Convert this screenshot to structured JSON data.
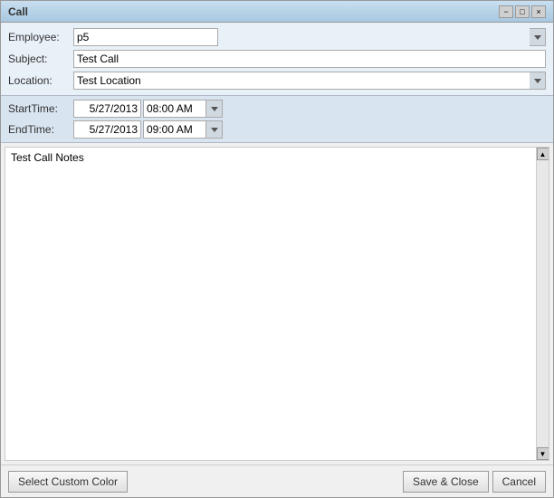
{
  "window": {
    "title": "Call",
    "subtitle": ""
  },
  "titleBar": {
    "minimize_label": "−",
    "maximize_label": "□",
    "close_label": "×"
  },
  "form": {
    "employee_label": "Employee:",
    "employee_value": "p5",
    "subject_label": "Subject:",
    "subject_value": "Test Call",
    "location_label": "Location:",
    "location_value": "Test Location"
  },
  "datetime": {
    "starttime_label": "StartTime:",
    "starttime_date": "5/27/2013",
    "starttime_time": "08:00 AM",
    "endtime_label": "EndTime:",
    "endtime_date": "5/27/2013",
    "endtime_time": "09:00 AM"
  },
  "notes": {
    "value": "Test Call Notes"
  },
  "buttons": {
    "select_custom_color": "Select Custom Color",
    "save_close": "Save & Close",
    "cancel": "Cancel"
  },
  "icons": {
    "dropdown_arrow": "▼",
    "scroll_up": "▲",
    "scroll_down": "▼"
  }
}
